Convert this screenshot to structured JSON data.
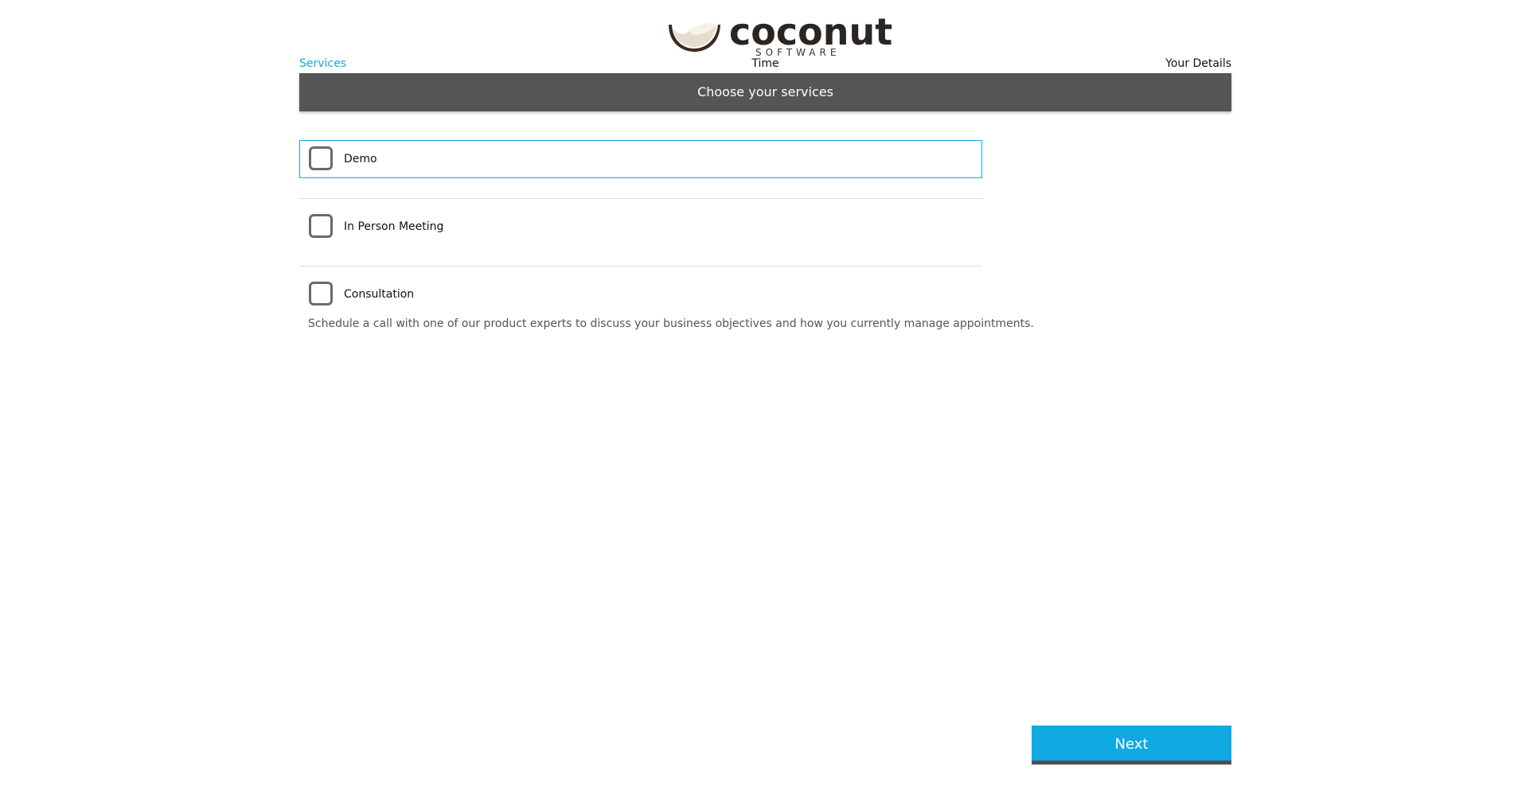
{
  "brand": {
    "name": "coconut",
    "tagline": "SOFTWARE"
  },
  "steps": [
    {
      "label": "Services",
      "active": true
    },
    {
      "label": "Time",
      "active": false
    },
    {
      "label": "Your Details",
      "active": false
    }
  ],
  "header": {
    "title": "Choose your services"
  },
  "services": [
    {
      "label": "Demo",
      "checked": false,
      "focused": true
    },
    {
      "label": "In Person Meeting",
      "checked": false,
      "focused": false
    },
    {
      "label": "Consultation",
      "checked": false,
      "focused": false,
      "description": "Schedule a call with one of our product experts to discuss your business objectives and how you currently manage appointments."
    }
  ],
  "actions": {
    "next_label": "Next"
  },
  "colors": {
    "accent": "#10a9e4",
    "header_bg": "#545555",
    "button_underline": "#4d4f50"
  }
}
